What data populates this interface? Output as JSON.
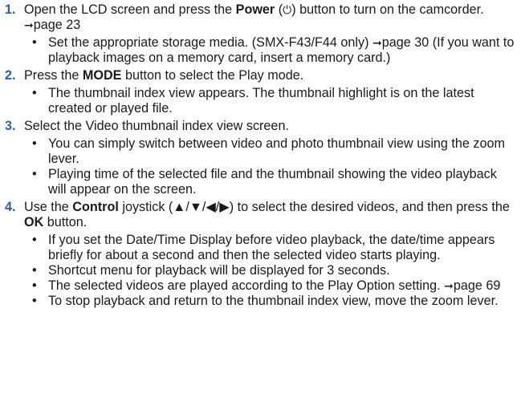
{
  "steps": [
    {
      "num": "1.",
      "parts": [
        "Open the LCD screen and press the ",
        "Power",
        " (",
        "⏻",
        ") button to turn on the camcorder. ",
        "➞",
        "page 23"
      ],
      "bullets": [
        [
          "Set the appropriate storage media. (SMX-F43/F44 only) ",
          "➞",
          "page 30 (If you want to playback images on a memory card, insert a memory card.)"
        ]
      ]
    },
    {
      "num": "2.",
      "parts": [
        "Press the ",
        "MODE",
        " button to select the Play mode."
      ],
      "bullets": [
        [
          "The thumbnail index view appears. The thumbnail highlight is on the latest created or played file."
        ]
      ]
    },
    {
      "num": "3.",
      "parts": [
        "Select the Video thumbnail index view screen."
      ],
      "bullets": [
        [
          "You can simply switch between video and photo thumbnail view using the zoom lever."
        ],
        [
          "Playing time of the selected file and the thumbnail showing the video playback will appear on the screen."
        ]
      ]
    },
    {
      "num": "4.",
      "parts": [
        "Use the ",
        "Control",
        " joystick (▲/▼/◀/▶) to select the desired videos, and then press the ",
        "OK",
        " button."
      ],
      "bullets": [
        [
          "If you set the Date/Time Display before video playback, the date/time appears briefly for about a second and then the selected video starts playing."
        ],
        [
          "Shortcut menu for playback will be displayed for 3 seconds."
        ],
        [
          "The selected videos are played according to the Play Option setting. ",
          "➞",
          "page 69"
        ],
        [
          "To stop playback and return to the thumbnail index view, move the zoom lever."
        ]
      ]
    }
  ],
  "bullet_char": "•"
}
